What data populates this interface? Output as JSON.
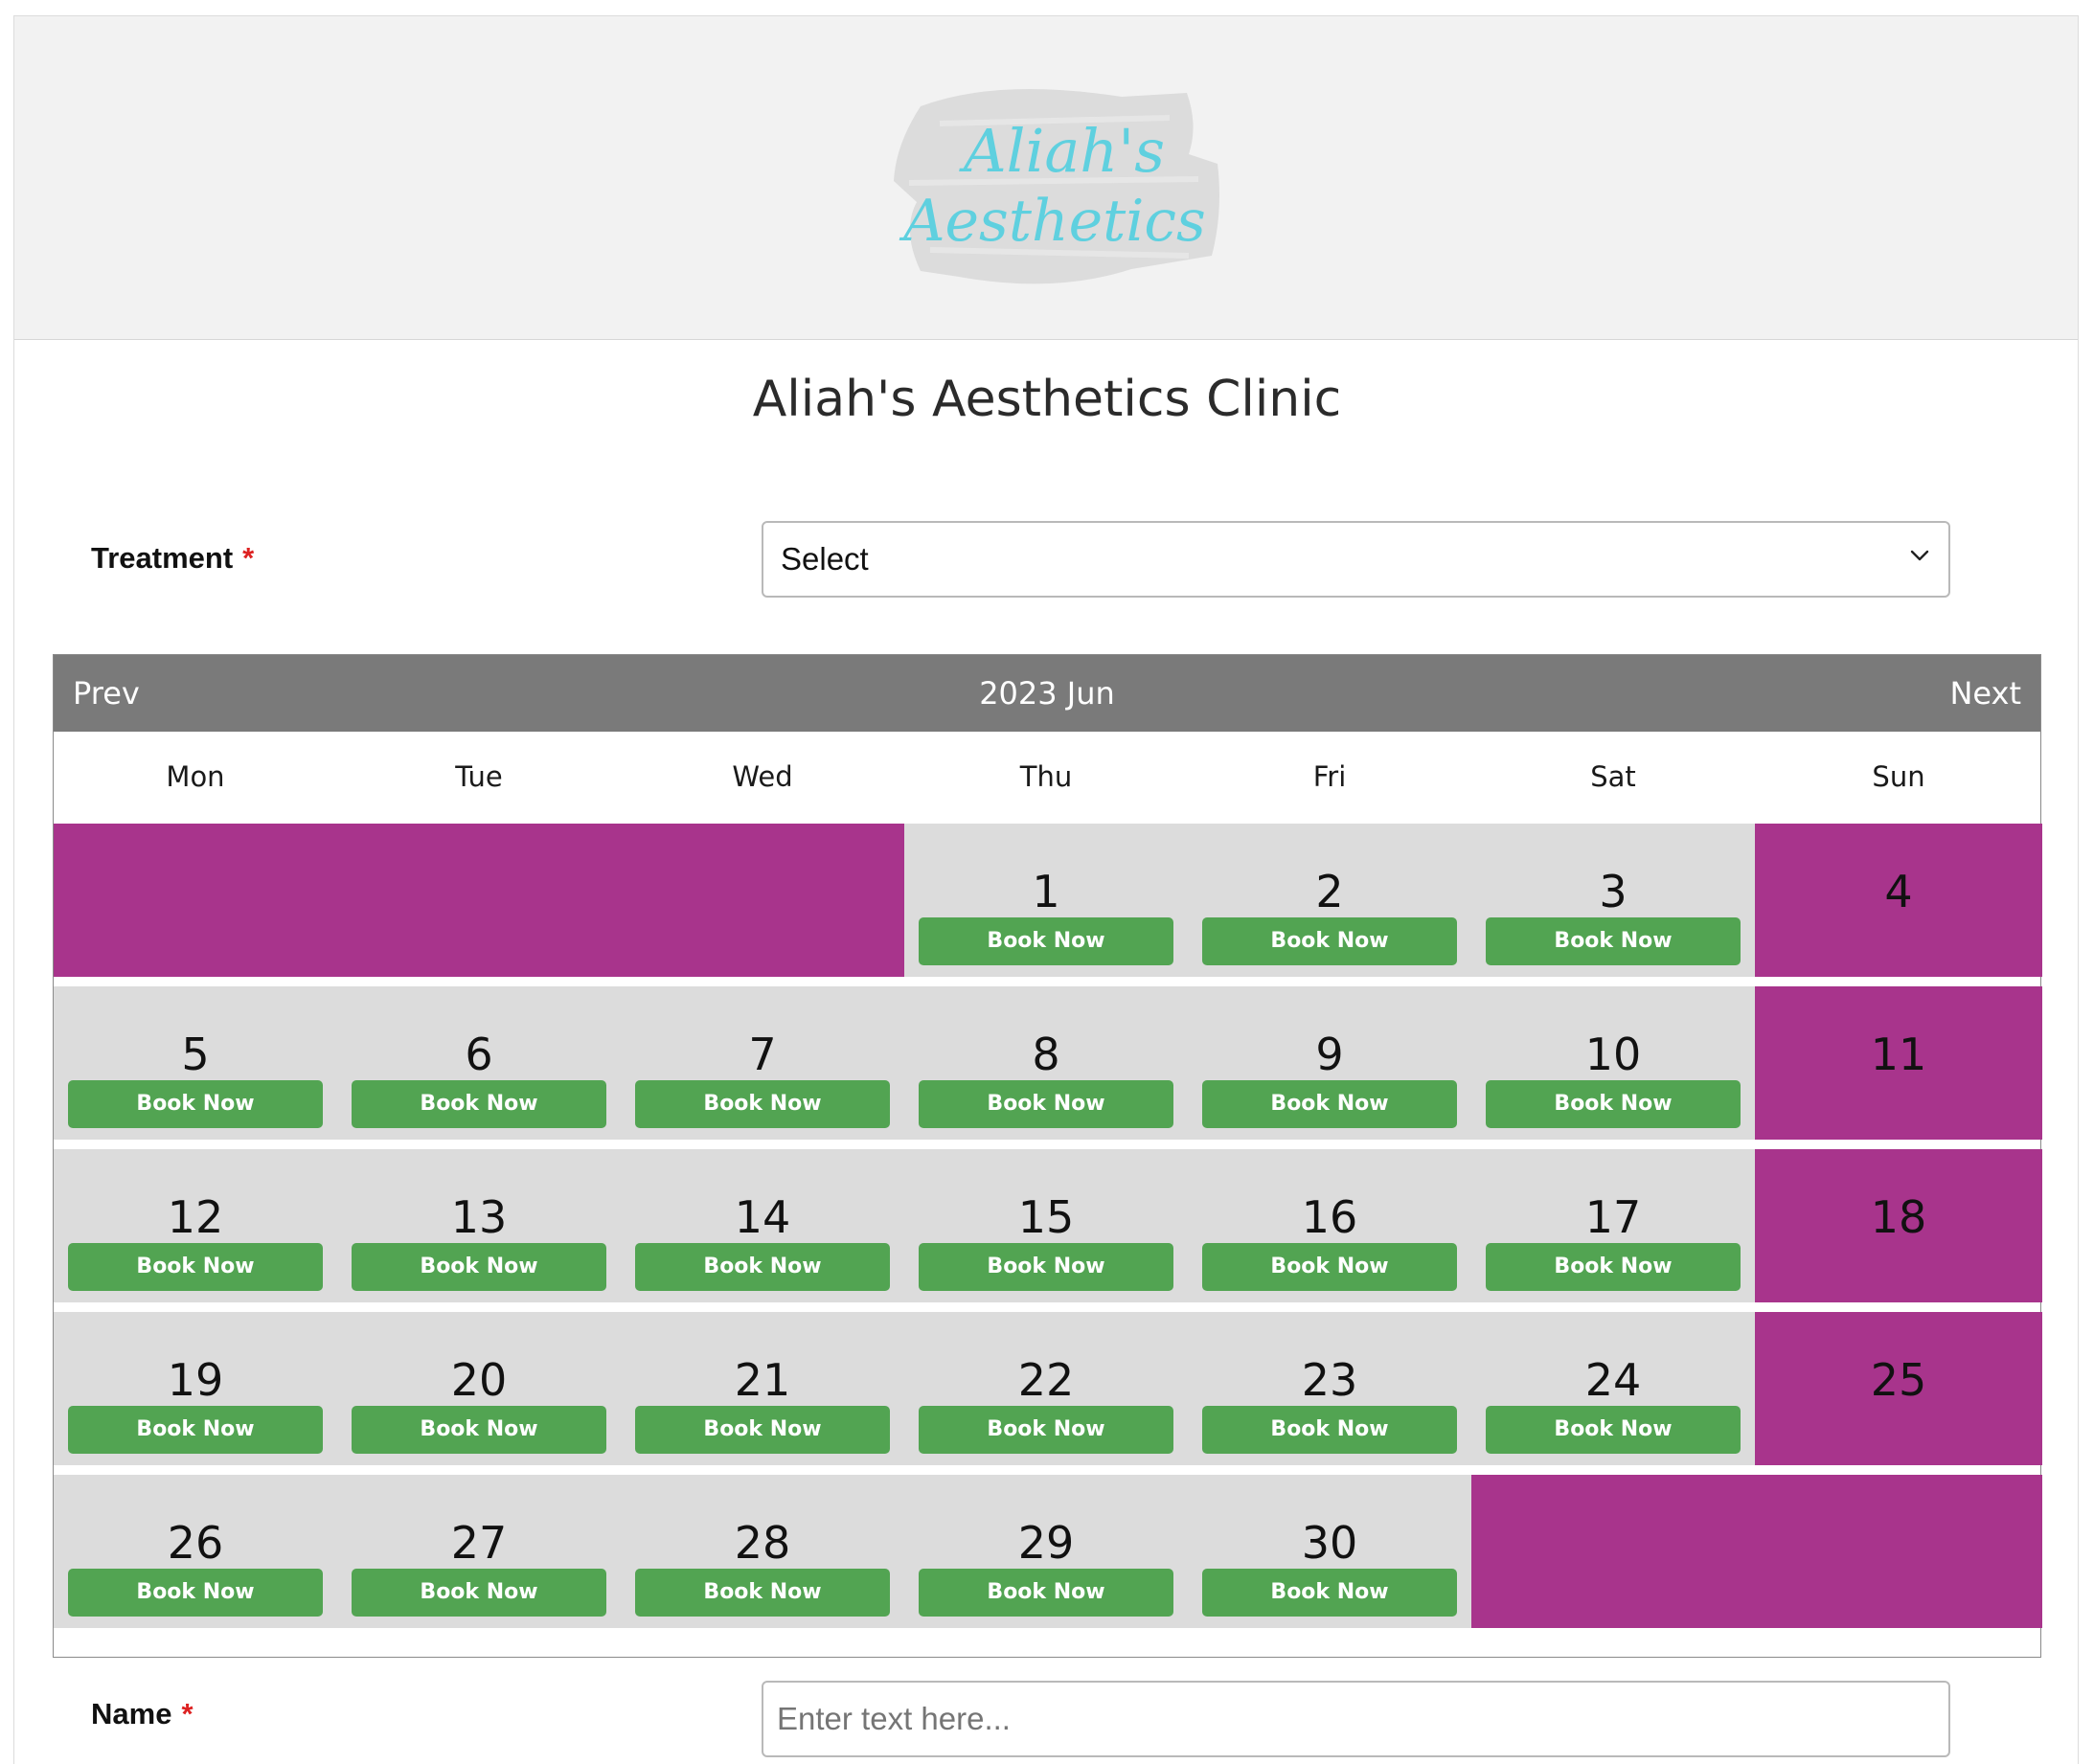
{
  "logo": {
    "line1": "Aliah's",
    "line2": "Aesthetics"
  },
  "page": {
    "title": "Aliah's Aesthetics Clinic"
  },
  "treatment": {
    "label": "Treatment",
    "required_mark": "*",
    "selected": "Select"
  },
  "calendar": {
    "prev": "Prev",
    "next": "Next",
    "title": "2023 Jun",
    "weekdays": [
      "Mon",
      "Tue",
      "Wed",
      "Thu",
      "Fri",
      "Sat",
      "Sun"
    ],
    "book_label": "Book Now",
    "bookable_color": "#52a452",
    "closed_color": "#a8348c",
    "open_cell_color": "#dcdcdc",
    "weeks": [
      [
        null,
        null,
        null,
        1,
        2,
        3,
        4
      ],
      [
        5,
        6,
        7,
        8,
        9,
        10,
        11
      ],
      [
        12,
        13,
        14,
        15,
        16,
        17,
        18
      ],
      [
        19,
        20,
        21,
        22,
        23,
        24,
        25
      ],
      [
        26,
        27,
        28,
        29,
        30,
        null,
        null
      ]
    ],
    "closed_weekday": "Sun"
  },
  "name": {
    "label": "Name",
    "required_mark": "*",
    "placeholder": "Enter text here..."
  }
}
